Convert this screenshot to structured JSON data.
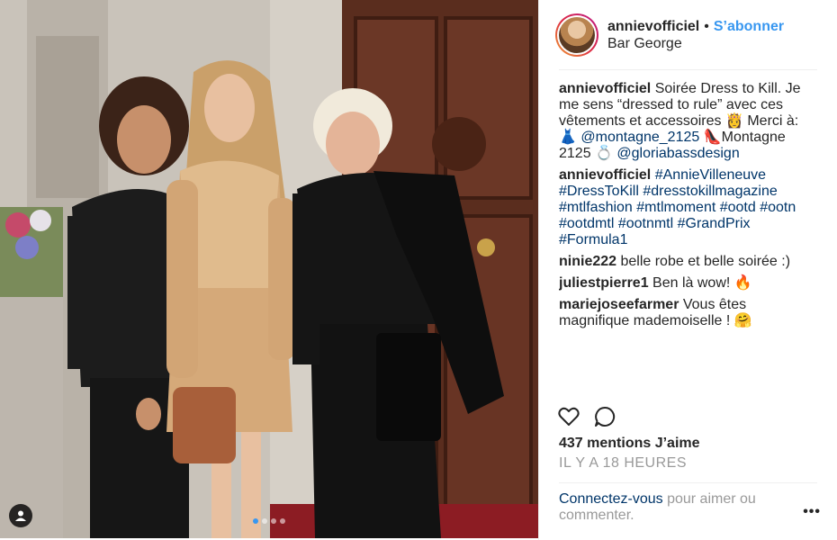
{
  "header": {
    "username": "annievofficiel",
    "separator": "•",
    "follow_label": "S’abonner",
    "location": "Bar George"
  },
  "comments": [
    {
      "user": "annievofficiel",
      "parts": [
        {
          "text": " Soirée Dress to Kill. Je me sens “dressed to rule” avec ces vêtements et accessoires 👸 Merci à: 👗 ",
          "link": false
        },
        {
          "text": "@montagne_2125",
          "link": true
        },
        {
          "text": " 👠Montagne 2125 💍 ",
          "link": false
        },
        {
          "text": "@gloriabassdesign",
          "link": true
        }
      ]
    },
    {
      "user": "annievofficiel",
      "parts": [
        {
          "text": " ",
          "link": false
        },
        {
          "text": "#AnnieVilleneuve #DressToKill #dresstokillmagazine #mtlfashion #mtlmoment #ootd #ootn #ootdmtl #ootnmtl #GrandPrix #Formula1",
          "link": true
        }
      ]
    },
    {
      "user": "ninie222",
      "parts": [
        {
          "text": " belle robe et belle soirée :)",
          "link": false
        }
      ]
    },
    {
      "user": "juliestpierre1",
      "parts": [
        {
          "text": " Ben là wow! 🔥",
          "link": false
        }
      ]
    },
    {
      "user": "mariejoseefarmer",
      "parts": [
        {
          "text": " Vous êtes magnifique mademoiselle ! 🤗",
          "link": false
        }
      ]
    }
  ],
  "actions": {
    "like_icon": "heart-icon",
    "comment_icon": "comment-icon"
  },
  "likes_text": "437 mentions J’aime",
  "time_text": "IL Y A 18 HEURES",
  "login": {
    "link_text": "Connectez-vous",
    "rest_text": " pour aimer ou commenter."
  },
  "more_label": "•••",
  "carousel": {
    "count": 4,
    "active": 0
  },
  "colors": {
    "accent": "#3897f0",
    "link": "#003569",
    "muted": "#999999"
  }
}
